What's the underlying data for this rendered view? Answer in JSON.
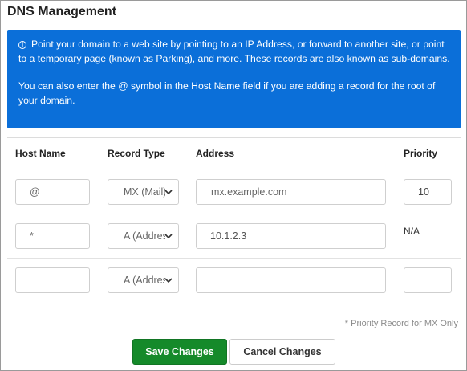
{
  "page": {
    "title": "DNS Management"
  },
  "info": {
    "icon": "info-circle-icon",
    "text1": "Point your domain to a web site by pointing to an IP Address, or forward to another site, or point to a temporary page (known as Parking), and more. These records are also known as sub-domains.",
    "text2": "You can also enter the @ symbol in the Host Name field if you are adding a record for the root of your domain.",
    "bg_color": "#0b6fd9"
  },
  "table": {
    "headers": {
      "host": "Host Name",
      "type": "Record Type",
      "address": "Address",
      "priority": "Priority"
    },
    "rows": [
      {
        "host": "@",
        "type": "MX (Mail)",
        "address": "mx.example.com",
        "priority": "10"
      },
      {
        "host": "*",
        "type": "A (Address)",
        "address": "10.1.2.3",
        "priority": "N/A"
      },
      {
        "host": "",
        "type": "A (Address)",
        "address": "",
        "priority": ""
      }
    ]
  },
  "note": "* Priority Record for MX Only",
  "buttons": {
    "save": "Save Changes",
    "cancel": "Cancel Changes",
    "save_color": "#158a2a"
  }
}
